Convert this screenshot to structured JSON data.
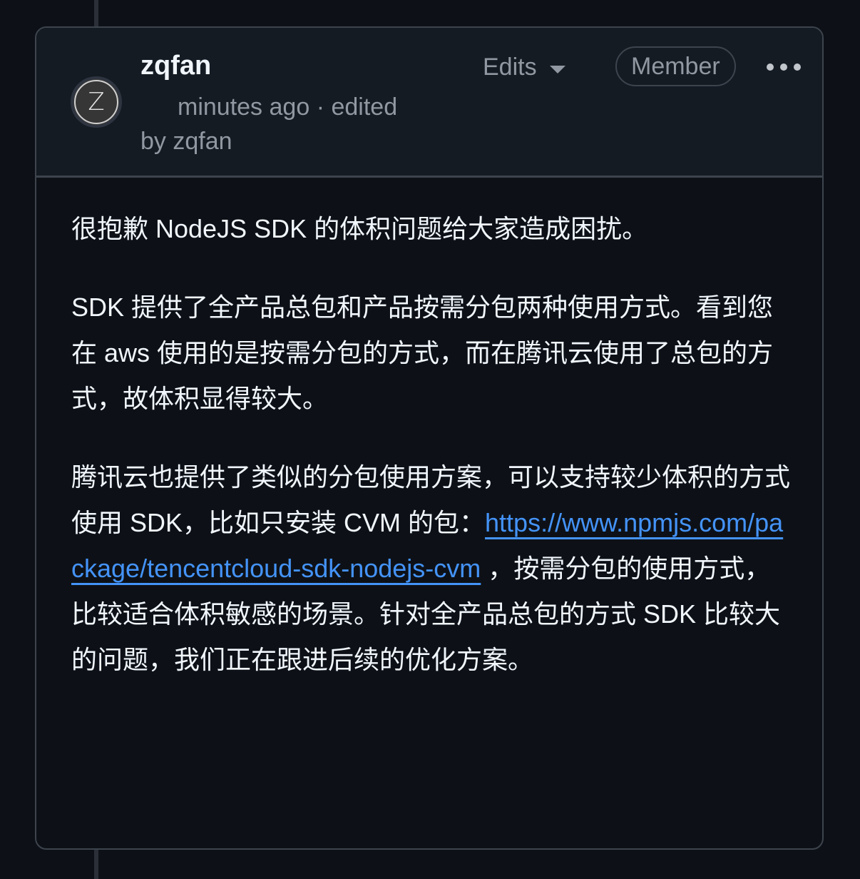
{
  "comment": {
    "author": "zqfan",
    "avatar_letter": "Z",
    "timestamp": "minutes ago",
    "edited_separator": "·",
    "edited_label": "edited",
    "edited_by": "by zqfan",
    "edits_menu_label": "Edits",
    "role_badge": "Member",
    "more_actions_icon": "kebab-horizontal-icon",
    "body": {
      "paragraph1": "很抱歉 NodeJS SDK 的体积问题给大家造成困扰。",
      "paragraph2": "SDK 提供了全产品总包和产品按需分包两种使用方式。看到您在 aws 使用的是按需分包的方式，而在腾讯云使用了总包的方式，故体积显得较大。",
      "paragraph3_before_link": "腾讯云也提供了类似的分包使用方案，可以支持较少体积的方式使用 SDK，比如只安装 CVM 的包：",
      "link_text": "https://www.npmjs.com/package/tencentcloud-sdk-nodejs-cvm",
      "paragraph3_after_link": " ，按需分包的使用方式，比较适合体积敏感的场景。针对全产品总包的方式 SDK 比较大的问题，我们正在跟进后续的优化方案。"
    }
  },
  "colors": {
    "background": "#0d1117",
    "header_background": "#151b23",
    "border": "#3d444d",
    "text_primary": "#f0f6fc",
    "text_muted": "#9198a1",
    "link": "#4493f8"
  }
}
